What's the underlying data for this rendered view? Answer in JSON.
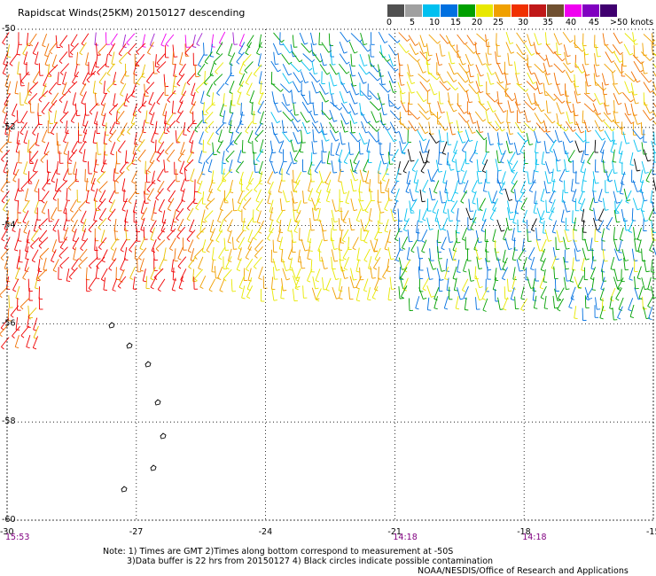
{
  "header": {
    "title": "Rapidscat Winds(25KM) 20150127 descending"
  },
  "legend": {
    "labels": [
      "0",
      "5",
      "10",
      "15",
      "20",
      "25",
      "30",
      "35",
      "40",
      "45",
      ">50 knots"
    ],
    "colors": [
      "#505050",
      "#a0a0a0",
      "#00c0f0",
      "#0070e0",
      "#00a000",
      "#e8e800",
      "#f0a000",
      "#f03000",
      "#c01818",
      "#705030",
      "#f000f0",
      "#8000c0",
      "#400070"
    ]
  },
  "map": {
    "lat_labels": [
      "-50",
      "-52",
      "-54",
      "-56",
      "-58",
      "-60"
    ],
    "lon_labels": [
      "-30",
      "-27",
      "-24",
      "-21",
      "-18",
      "-15"
    ],
    "time_labels": [
      {
        "text": "15:53",
        "lon": -30
      },
      {
        "text": "14:18",
        "lon": -21
      },
      {
        "text": "14:18",
        "lon": -18
      }
    ]
  },
  "notes": {
    "line1": "Note: 1) Times are GMT 2)Times along bottom correspond to measurement at -50S",
    "line2": "3)Data buffer is 22 hrs from 20150127 4) Black circles indicate possible contamination",
    "credit": "NOAA/NESDIS/Office of Research and Applications"
  }
}
